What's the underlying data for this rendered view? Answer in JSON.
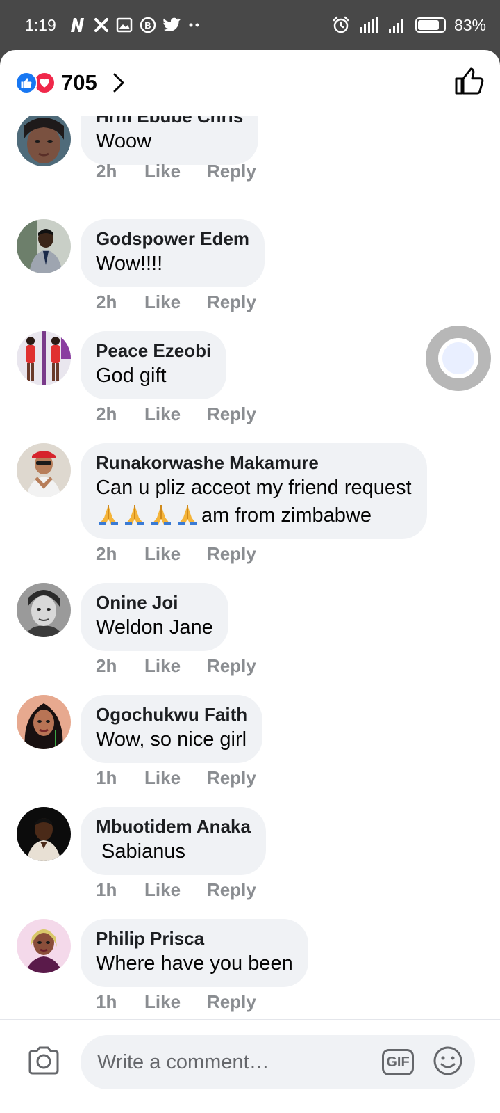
{
  "status_bar": {
    "time": "1:19",
    "battery": "83%",
    "battery_level": 0.83,
    "left_icons": [
      "netflix-n-icon",
      "x-icon",
      "gallery-icon",
      "bold-b-icon",
      "twitter-icon",
      "more-dots-icon"
    ],
    "right_icons": [
      "alarm-icon",
      "signal-4g-icon",
      "signal-bars-icon",
      "battery-icon"
    ]
  },
  "header": {
    "reaction_count": "705",
    "reaction_icons": [
      "like-reaction-icon",
      "love-reaction-icon"
    ],
    "chevron_icon": "chevron-right-icon",
    "like_icon": "thumbs-up-icon"
  },
  "comments": [
    {
      "name": "Hrm Ebube Chris",
      "text": "Woow",
      "time": "2h",
      "like": "Like",
      "reply": "Reply"
    },
    {
      "name": "Godspower Edem",
      "text": "Wow!!!!",
      "time": "2h",
      "like": "Like",
      "reply": "Reply"
    },
    {
      "name": "Peace Ezeobi",
      "text": "God gift",
      "time": "2h",
      "like": "Like",
      "reply": "Reply"
    },
    {
      "name": "Runakorwashe Makamure",
      "text": "Can u pliz acceot my friend request",
      "text_line2": "am from zimbabwe",
      "emoji": "🙏🙏🙏🙏",
      "time": "2h",
      "like": "Like",
      "reply": "Reply"
    },
    {
      "name": "Onine Joi",
      "text": "Weldon Jane",
      "time": "2h",
      "like": "Like",
      "reply": "Reply"
    },
    {
      "name": "Ogochukwu Faith",
      "text": "Wow, so nice girl",
      "time": "1h",
      "like": "Like",
      "reply": "Reply"
    },
    {
      "name": "Mbuotidem Anaka",
      "text": " Sabianus",
      "time": "1h",
      "like": "Like",
      "reply": "Reply"
    },
    {
      "name": "Philip Prisca",
      "text": "Where have you been",
      "time": "1h",
      "like": "Like",
      "reply": "Reply"
    }
  ],
  "composer": {
    "placeholder": "Write a comment…",
    "gif_label": "GIF",
    "camera_icon": "camera-icon",
    "emoji_icon": "smiley-icon"
  },
  "colors": {
    "status_bar_bg": "#484848",
    "bubble_bg": "#f0f2f5",
    "action_text": "#8a8d91",
    "like_blue": "#1877f2",
    "love_red": "#f0284a"
  }
}
